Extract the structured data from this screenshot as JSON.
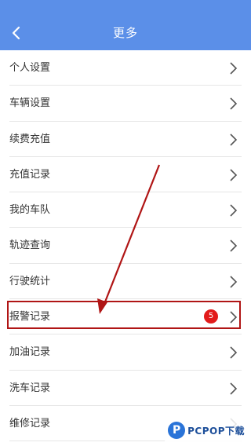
{
  "colors": {
    "header_bg": "#5b8fe8",
    "annotation_red": "#b01515",
    "badge_red": "#e21b1b"
  },
  "header": {
    "title": "更多",
    "back_icon": "chevron-left-icon"
  },
  "menu": {
    "items": [
      {
        "label": "个人设置"
      },
      {
        "label": "车辆设置"
      },
      {
        "label": "续费充值"
      },
      {
        "label": "充值记录"
      },
      {
        "label": "我的车队"
      },
      {
        "label": "轨迹查询"
      },
      {
        "label": "行驶统计"
      },
      {
        "label": "报警记录",
        "badge": "5"
      },
      {
        "label": "加油记录"
      },
      {
        "label": "洗车记录"
      },
      {
        "label": "维修记录"
      }
    ]
  },
  "watermark": {
    "logo_text": "P",
    "text": "PCPOP下载"
  }
}
